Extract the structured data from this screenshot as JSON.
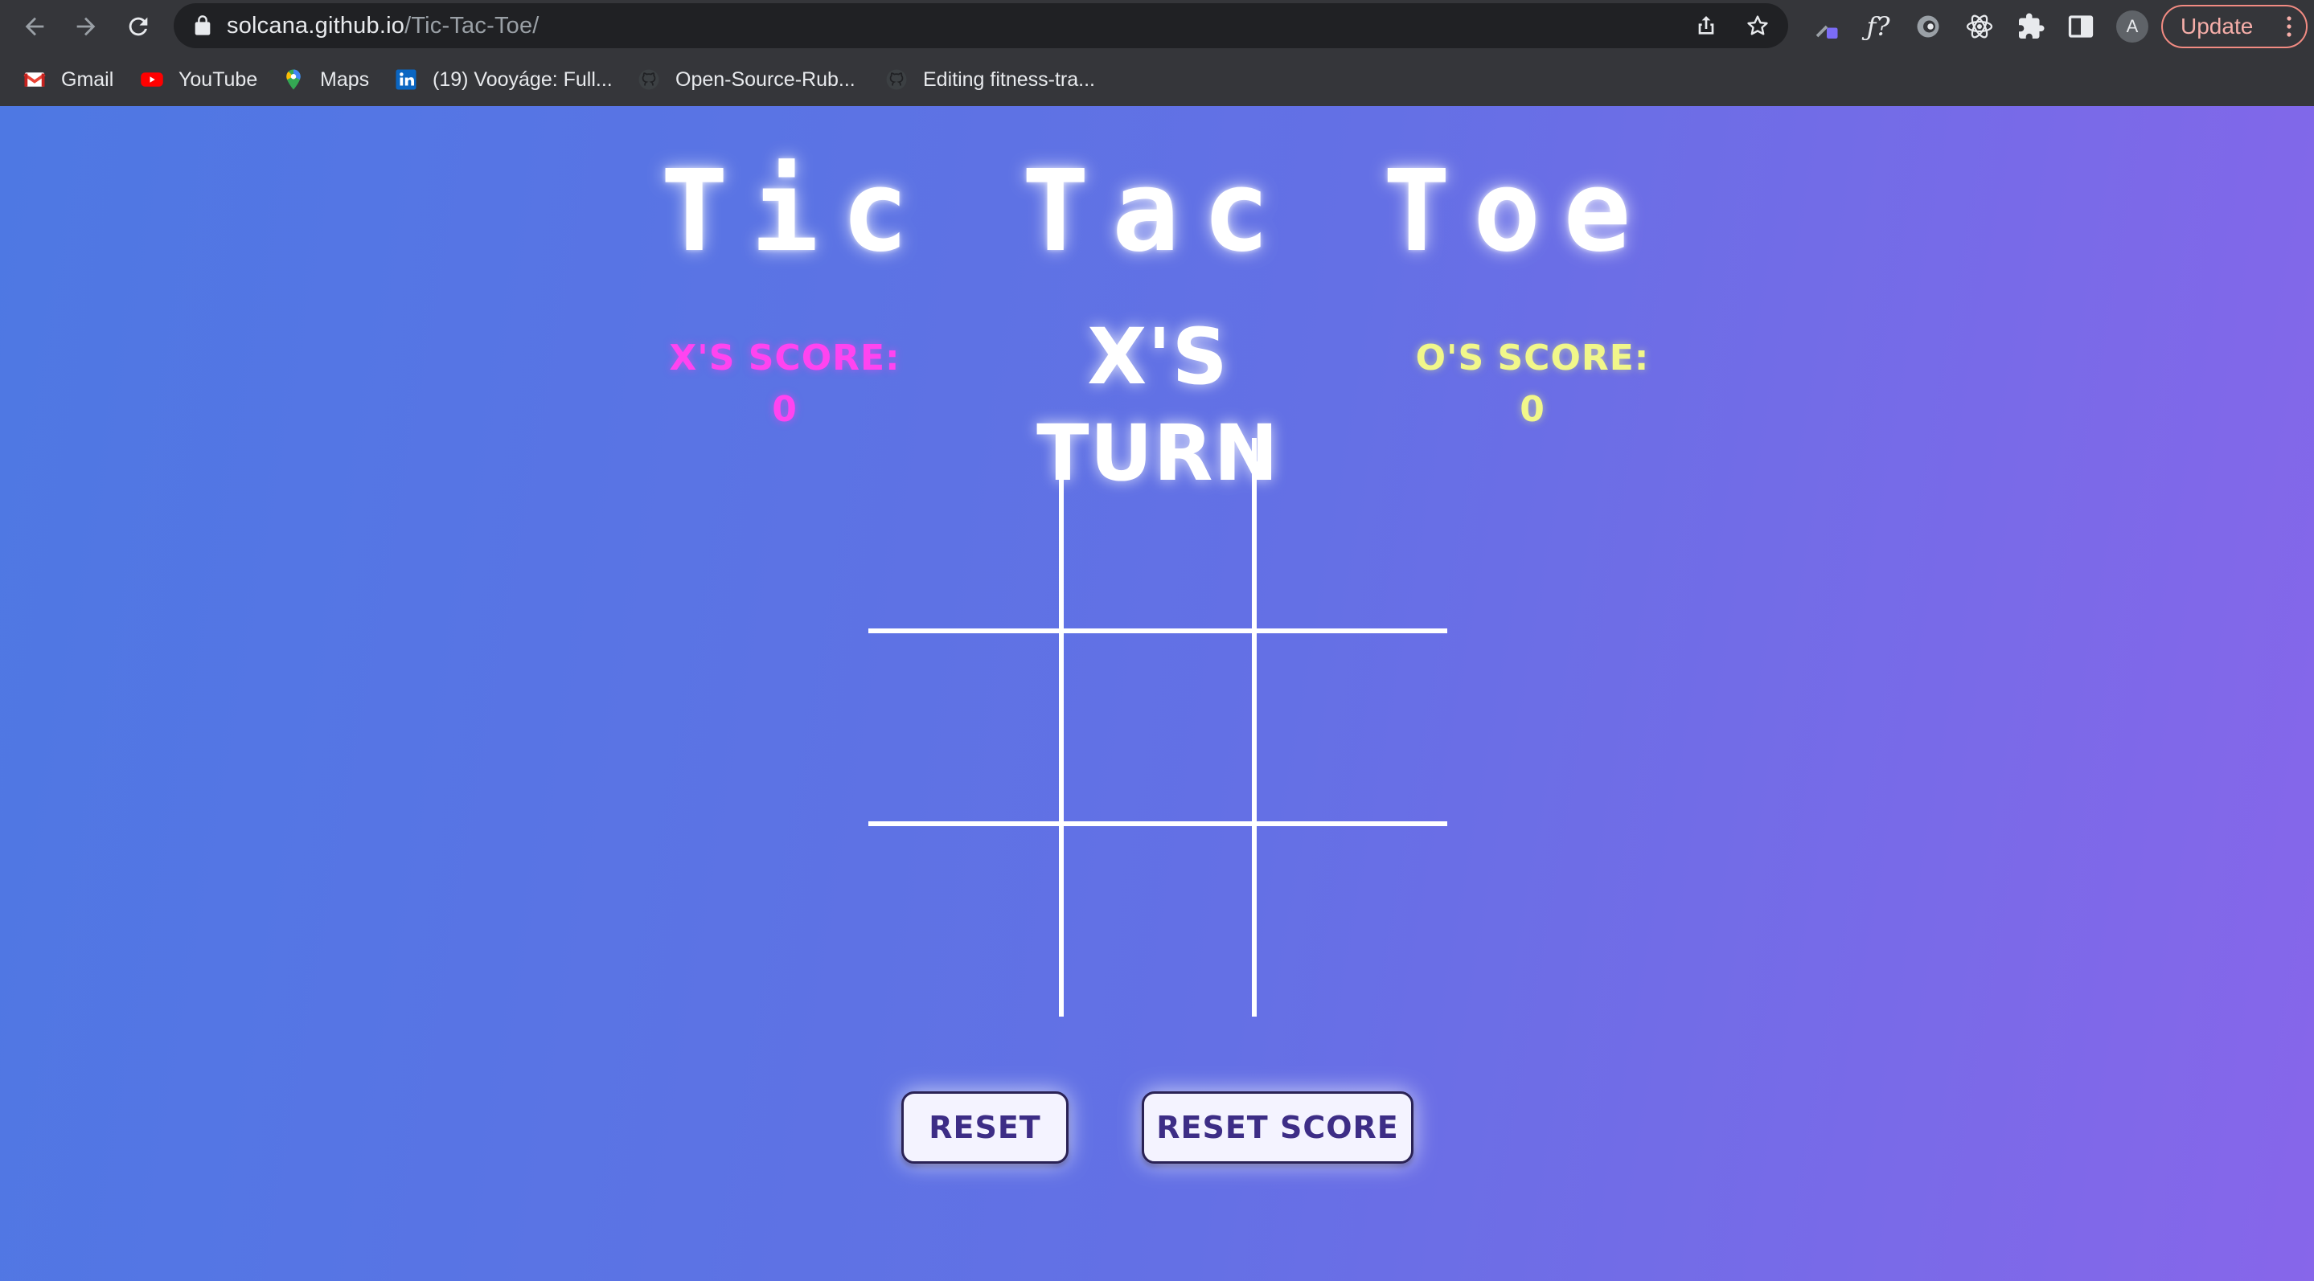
{
  "browser": {
    "url_host": "solcana.github.io",
    "url_path": "/Tic-Tac-Toe/",
    "profile_initial": "A",
    "update_label": "Update",
    "extension_formula_label": "ƒ?",
    "bookmarks": [
      {
        "label": "Gmail",
        "icon": "gmail-icon"
      },
      {
        "label": "YouTube",
        "icon": "youtube-icon"
      },
      {
        "label": "Maps",
        "icon": "maps-icon"
      },
      {
        "label": "(19) Vooyáge: Full...",
        "icon": "linkedin-icon"
      },
      {
        "label": "Open-Source-Rub...",
        "icon": "github-icon"
      },
      {
        "label": "Editing fitness-tra...",
        "icon": "github-icon"
      }
    ]
  },
  "game": {
    "title": "Tic Tac Toe",
    "x_score_label": "X'S SCORE: 0",
    "o_score_label": "O'S SCORE: 0",
    "turn_label": "X'S TURN",
    "x_score": 0,
    "o_score": 0,
    "cells": [
      "",
      "",
      "",
      "",
      "",
      "",
      "",
      "",
      ""
    ],
    "reset_label": "RESET",
    "reset_score_label": "RESET SCORE"
  },
  "colors": {
    "x_accent": "#ff44f0",
    "o_accent": "#f1f78a",
    "button_text": "#3d2d86",
    "gradient_start": "#4e78e3",
    "gradient_end": "#8766ea"
  }
}
